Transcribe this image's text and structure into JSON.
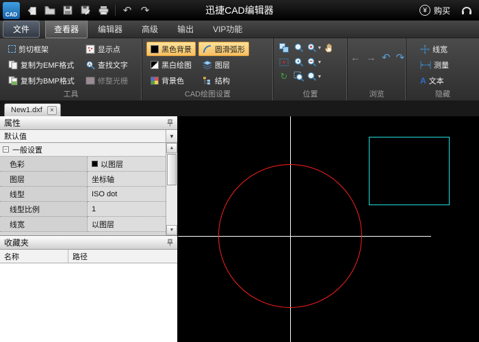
{
  "colors": {
    "accent_highlight": "#e09c32",
    "canvas_bg": "#000000",
    "crosshair": "#ffffff",
    "circle": "#ff2020",
    "selection_rect": "#20e0e0"
  },
  "titlebar": {
    "logo_text": "CAD",
    "title": "迅捷CAD编辑器",
    "buy_symbol": "¥",
    "buy_label": "购买"
  },
  "menubar": {
    "file_label": "文件",
    "tabs": [
      {
        "label": "查看器"
      },
      {
        "label": "编辑器"
      },
      {
        "label": "高级"
      },
      {
        "label": "输出"
      },
      {
        "label": "VIP功能"
      }
    ]
  },
  "ribbon": {
    "tools": {
      "label": "工具",
      "col1": [
        {
          "label": "剪切框架"
        },
        {
          "label": "复制为EMF格式"
        },
        {
          "label": "复制为BMP格式"
        }
      ],
      "col2": [
        {
          "label": "显示点"
        },
        {
          "label": "查找文字"
        },
        {
          "label": "修整光栅"
        }
      ]
    },
    "cad": {
      "label": "CAD绘图设置",
      "col1": [
        {
          "label": "黑色背景"
        },
        {
          "label": "黑白绘图"
        },
        {
          "label": "背景色"
        }
      ],
      "col2": [
        {
          "label": "圆滑弧形"
        },
        {
          "label": "图层"
        },
        {
          "label": "结构"
        }
      ]
    },
    "position": {
      "label": "位置"
    },
    "browse": {
      "label": "浏览"
    },
    "hide": {
      "label": "隐藏",
      "items": [
        {
          "label": "线宽"
        },
        {
          "label": "测量"
        },
        {
          "label": "文本"
        }
      ]
    }
  },
  "doctabs": {
    "active": "New1.dxf",
    "close_glyph": "×"
  },
  "properties": {
    "title": "属性",
    "preset": "默认值",
    "section": "一般设置",
    "swatch_color": "#000000",
    "rows": [
      {
        "label": "色彩",
        "value": "以图层"
      },
      {
        "label": "图层",
        "value": "坐标轴"
      },
      {
        "label": "线型",
        "value": "ISO dot"
      },
      {
        "label": "线型比例",
        "value": "1"
      },
      {
        "label": "线宽",
        "value": "以图层"
      }
    ]
  },
  "favorites": {
    "title": "收藏夹",
    "columns": [
      {
        "label": "名称"
      },
      {
        "label": "路径"
      }
    ]
  }
}
